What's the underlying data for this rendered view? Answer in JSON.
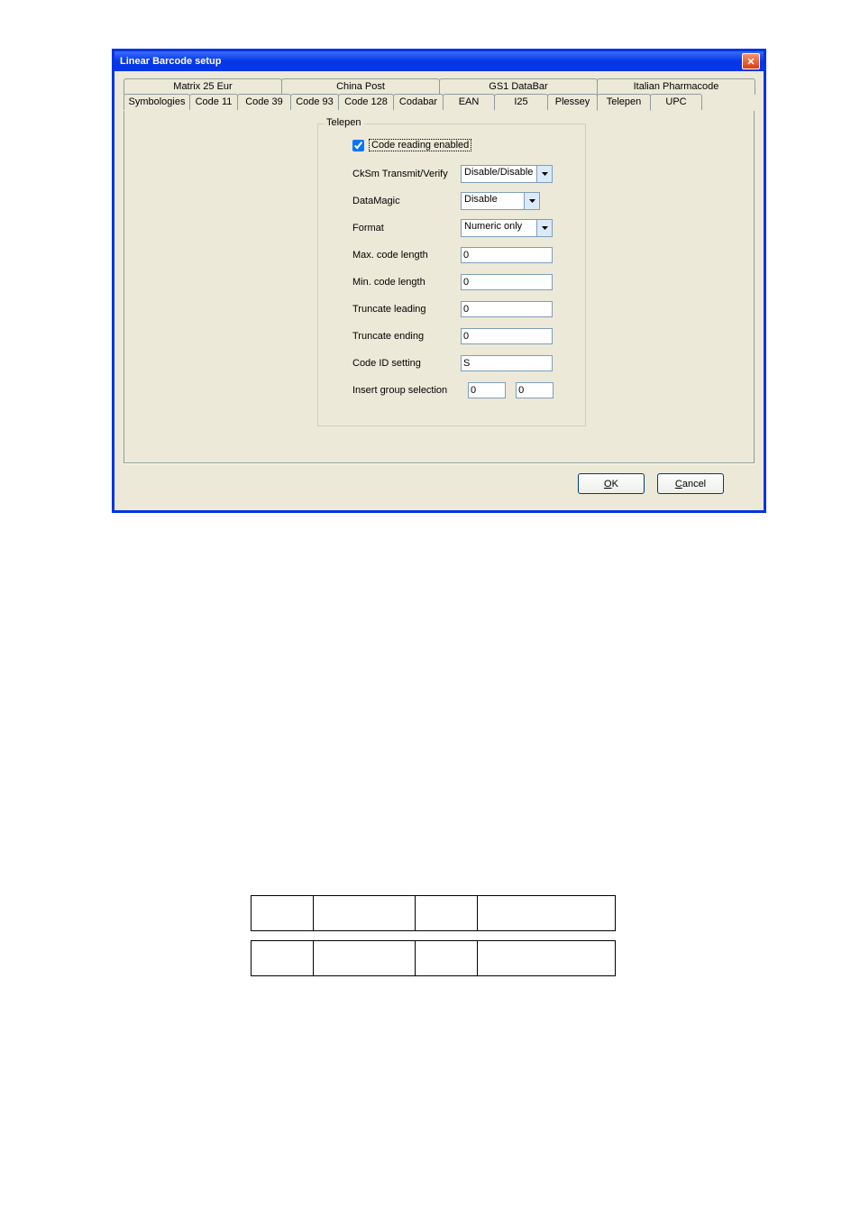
{
  "window": {
    "title": "Linear Barcode setup"
  },
  "tabs": {
    "row1": [
      "Matrix 25 Eur",
      "China Post",
      "GS1 DataBar",
      "Italian Pharmacode"
    ],
    "row2": [
      "Symbologies",
      "Code 11",
      "Code 39",
      "Code 93",
      "Code 128",
      "Codabar",
      "EAN",
      "I25",
      "Plessey",
      "Telepen",
      "UPC"
    ],
    "selected": "Telepen"
  },
  "group": {
    "title": "Telepen",
    "checkbox_label": "Code reading enabled",
    "checkbox_checked": true,
    "fields": {
      "cksm": {
        "label": "CkSm Transmit/Verify",
        "value": "Disable/Disable"
      },
      "dm": {
        "label": "DataMagic",
        "value": "Disable"
      },
      "fmt": {
        "label": "Format",
        "value": "Numeric only"
      },
      "max": {
        "label": "Max. code length",
        "value": "0"
      },
      "min": {
        "label": "Min. code length",
        "value": "0"
      },
      "tl": {
        "label": "Truncate leading",
        "value": "0"
      },
      "te": {
        "label": "Truncate ending",
        "value": "0"
      },
      "cid": {
        "label": "Code ID setting",
        "value": "S"
      },
      "igs": {
        "label": "Insert group selection",
        "value1": "0",
        "value2": "0"
      }
    }
  },
  "buttons": {
    "ok": "OK",
    "cancel": "Cancel"
  }
}
